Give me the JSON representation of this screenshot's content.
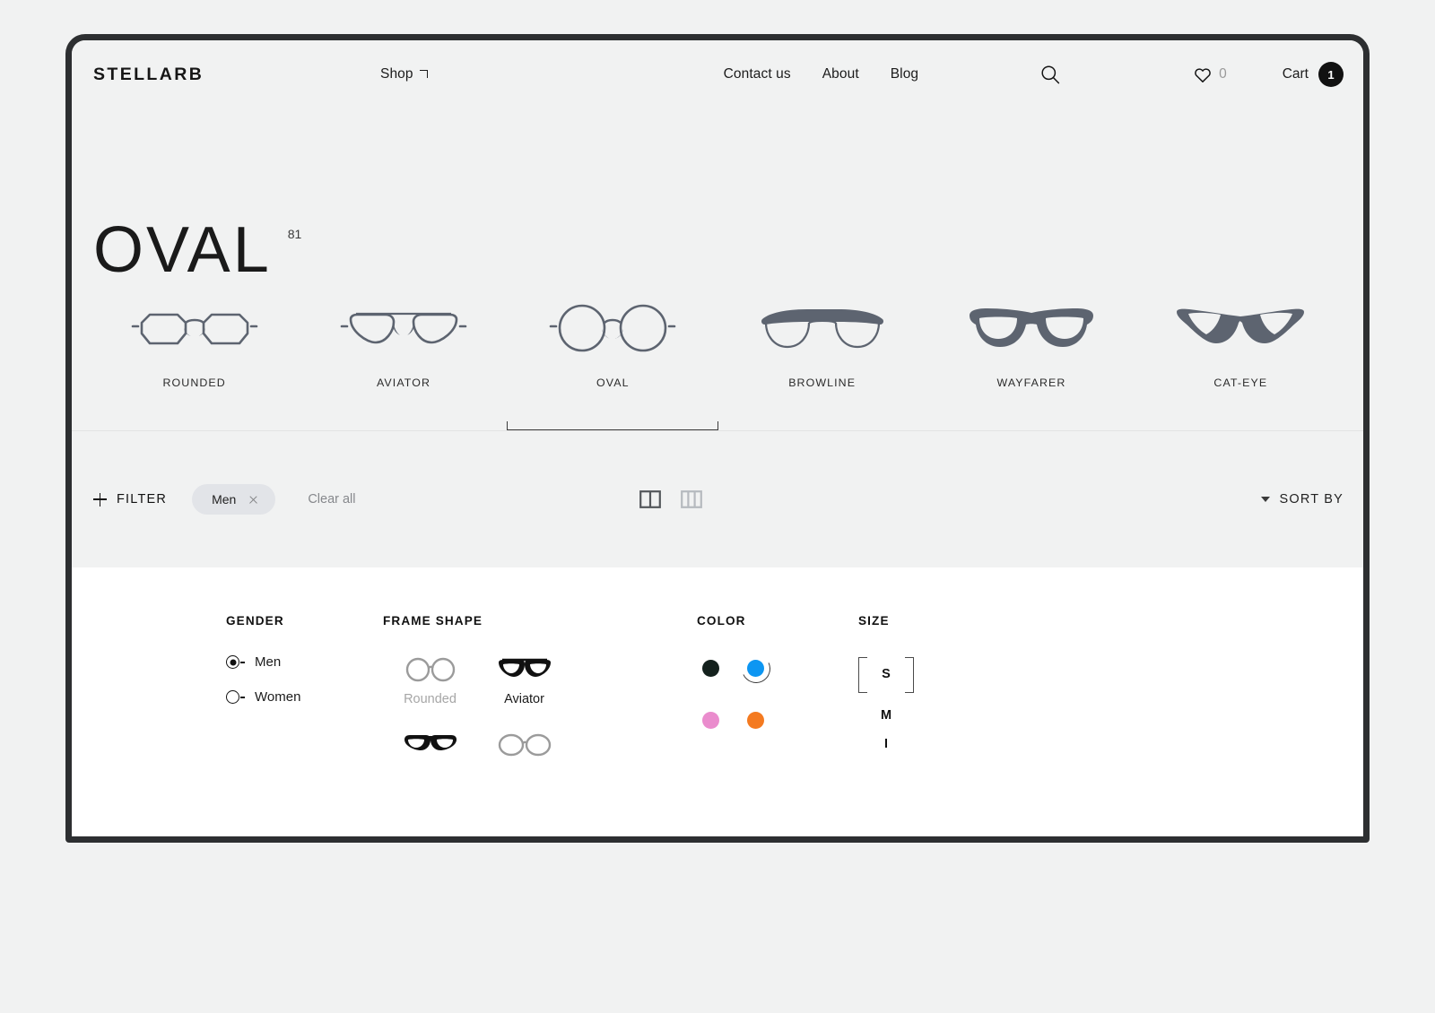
{
  "header": {
    "brand": "STELLARB",
    "shop_label": "Shop",
    "nav_links": [
      {
        "label": "Contact us",
        "name": "nav-contact-us"
      },
      {
        "label": "About",
        "name": "nav-about"
      },
      {
        "label": "Blog",
        "name": "nav-blog"
      }
    ],
    "search_icon": "search-icon",
    "wishlist_icon": "heart-icon",
    "wishlist_count": "0",
    "cart_label": "Cart",
    "cart_count": "1"
  },
  "page": {
    "title": "OVAL",
    "count": "81"
  },
  "shape_tabs": [
    {
      "label": "ROUNDED",
      "active": false
    },
    {
      "label": "AVIATOR",
      "active": false
    },
    {
      "label": "OVAL",
      "active": true
    },
    {
      "label": "BROWLINE",
      "active": false
    },
    {
      "label": "WAYFARER",
      "active": false
    },
    {
      "label": "CAT-EYE",
      "active": false
    }
  ],
  "filter_bar": {
    "filter_label": "FILTER",
    "active_chips": [
      {
        "label": "Men"
      }
    ],
    "clear_all_label": "Clear all",
    "view_two_col": "grid-2-col-icon",
    "view_three_col": "grid-3-col-icon",
    "sort_by_label": "SORT BY"
  },
  "filter_panel": {
    "gender": {
      "title": "GENDER",
      "options": [
        {
          "label": "Men",
          "selected": true
        },
        {
          "label": "Women",
          "selected": false
        }
      ]
    },
    "frame_shape": {
      "title": "FRAME SHAPE",
      "options": [
        {
          "label": "Rounded",
          "icon": "rounded-glasses-icon",
          "dim": true
        },
        {
          "label": "Aviator",
          "icon": "aviator-glasses-icon",
          "dim": false
        },
        {
          "label": "",
          "icon": "browline-glasses-icon",
          "dim": false
        },
        {
          "label": "",
          "icon": "oval-glasses-icon",
          "dim": true
        }
      ]
    },
    "color": {
      "title": "COLOR",
      "swatches": [
        {
          "name": "black",
          "hex": "#14211d",
          "selected": false
        },
        {
          "name": "blue",
          "hex": "#0d96f2",
          "selected": true
        },
        {
          "name": "pink",
          "hex": "#ea8ccd",
          "selected": false
        },
        {
          "name": "orange",
          "hex": "#f47a20",
          "selected": false
        }
      ]
    },
    "size": {
      "title": "SIZE",
      "options": [
        {
          "label": "S",
          "selected": true
        },
        {
          "label": "M",
          "selected": false
        }
      ]
    }
  },
  "colors": {
    "page_background": "#f1f2f2",
    "frame_border": "#2d2f31",
    "panel_background": "#ffffff",
    "chip_background": "#e2e4e8",
    "accent_dark": "#111111"
  }
}
